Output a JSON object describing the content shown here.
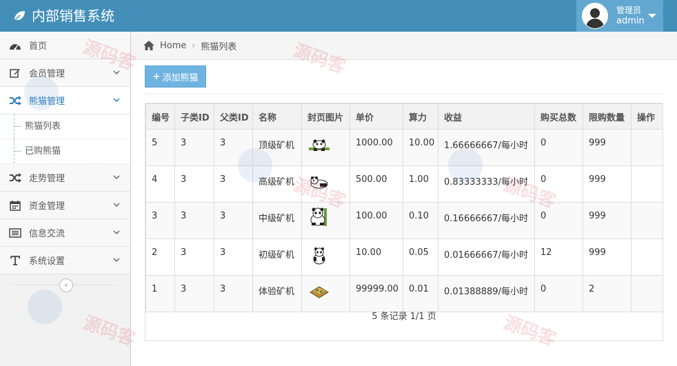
{
  "app": {
    "title": "内部销售系统"
  },
  "user": {
    "role": "管理员",
    "name": "admin"
  },
  "sidebar": {
    "items": [
      {
        "label": "首页"
      },
      {
        "label": "会员管理"
      },
      {
        "label": "熊猫管理"
      },
      {
        "label": "走势管理"
      },
      {
        "label": "资金管理"
      },
      {
        "label": "信息交流"
      },
      {
        "label": "系统设置"
      }
    ],
    "sub_items": [
      {
        "label": "熊猫列表"
      },
      {
        "label": "已购熊猫"
      }
    ],
    "collapse_glyph": "«"
  },
  "breadcrumb": {
    "home": "Home",
    "current": "熊猫列表"
  },
  "toolbar": {
    "add_label": "添加熊猫",
    "add_glyph": "+"
  },
  "table": {
    "headers": [
      "编号",
      "子类ID",
      "父类ID",
      "名称",
      "封页图片",
      "单价",
      "算力",
      "收益",
      "购买总数",
      "限购数量",
      "操作"
    ],
    "rows": [
      [
        "5",
        "3",
        "3",
        "顶级矿机",
        "",
        "1000.00",
        "10.00",
        "1.66666667/每小时",
        "0",
        "999",
        ""
      ],
      [
        "4",
        "3",
        "3",
        "高级矿机",
        "",
        "500.00",
        "1.00",
        "0.83333333/每小时",
        "0",
        "999",
        ""
      ],
      [
        "3",
        "3",
        "3",
        "中级矿机",
        "",
        "100.00",
        "0.10",
        "0.16666667/每小时",
        "0",
        "999",
        ""
      ],
      [
        "2",
        "3",
        "3",
        "初级矿机",
        "",
        "10.00",
        "0.05",
        "0.01666667/每小时",
        "12",
        "999",
        ""
      ],
      [
        "1",
        "3",
        "3",
        "体验矿机",
        "",
        "99999.00",
        "0.01",
        "0.01388889/每小时",
        "0",
        "2",
        ""
      ]
    ],
    "thumb_icons": [
      "panda-on-bamboo-icon",
      "panda-lying-icon",
      "panda-sitting-icon",
      "panda-small-icon",
      "mining-crate-icon"
    ]
  },
  "pagination": {
    "text": "5 条记录 1/1 页"
  },
  "watermark": {
    "text": "源码客"
  },
  "colors": {
    "header": "#438eb9",
    "user_box": "#62a8d1",
    "accent": "#2b7dbc",
    "button": "#6fb3e0"
  }
}
